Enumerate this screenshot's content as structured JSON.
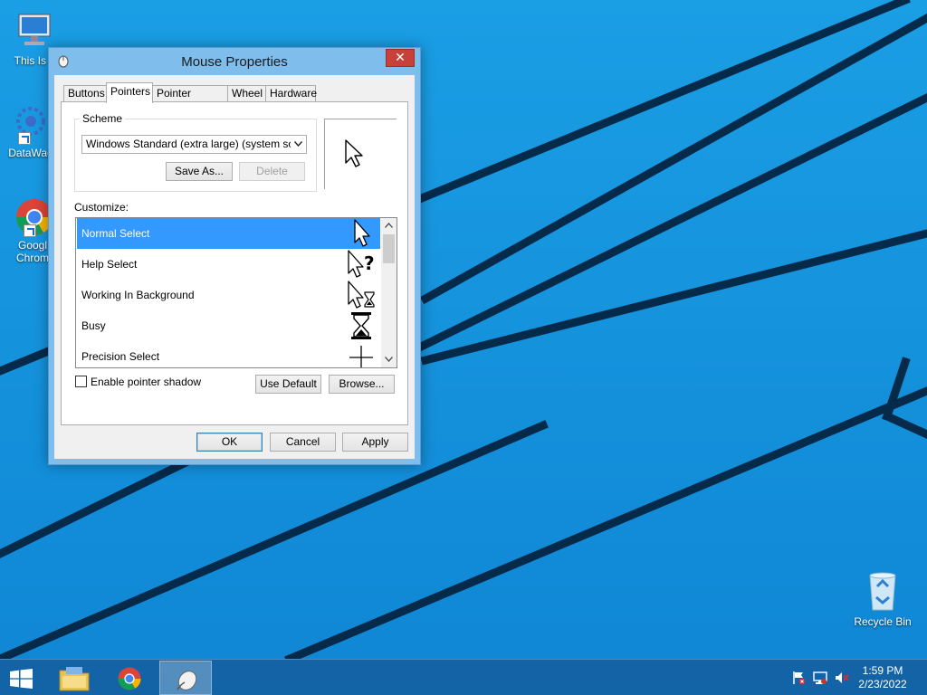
{
  "desktop": {
    "icons": [
      {
        "label": "This Is P",
        "icon": "computer-icon"
      },
      {
        "label": "DataWag",
        "icon": "datawag-app-icon"
      },
      {
        "label": "Googl\nChrom",
        "label_line1": "Googl",
        "label_line2": "Chrom",
        "icon": "chrome-icon"
      },
      {
        "label": "Recycle Bin",
        "icon": "recycle-bin-icon"
      }
    ]
  },
  "dialog": {
    "title": "Mouse Properties",
    "close_glyph": "✕",
    "tabs": [
      {
        "label": "Buttons"
      },
      {
        "label": "Pointers",
        "active": true
      },
      {
        "label": "Pointer Options"
      },
      {
        "label": "Wheel"
      },
      {
        "label": "Hardware"
      }
    ],
    "scheme": {
      "group_label": "Scheme",
      "selected": "Windows Standard (extra large) (system scheme",
      "save_as_label": "Save As...",
      "delete_label": "Delete"
    },
    "customize_label": "Customize:",
    "pointers": [
      {
        "name": "Normal Select",
        "cursor": "arrow-cursor-icon",
        "selected": true
      },
      {
        "name": "Help Select",
        "cursor": "help-cursor-icon"
      },
      {
        "name": "Working In Background",
        "cursor": "working-cursor-icon"
      },
      {
        "name": "Busy",
        "cursor": "busy-hourglass-icon"
      },
      {
        "name": "Precision Select",
        "cursor": "crosshair-icon"
      }
    ],
    "enable_shadow_label": "Enable pointer shadow",
    "enable_shadow_checked": false,
    "use_default_label": "Use Default",
    "browse_label": "Browse...",
    "ok_label": "OK",
    "cancel_label": "Cancel",
    "apply_label": "Apply"
  },
  "taskbar": {
    "clock_time": "1:59 PM",
    "clock_date": "2/23/2022"
  },
  "colors": {
    "desktop_blue": "#1592dc",
    "selection": "#3399ff",
    "dialog_frame": "#7ebdec",
    "close_button": "#c7413a"
  }
}
